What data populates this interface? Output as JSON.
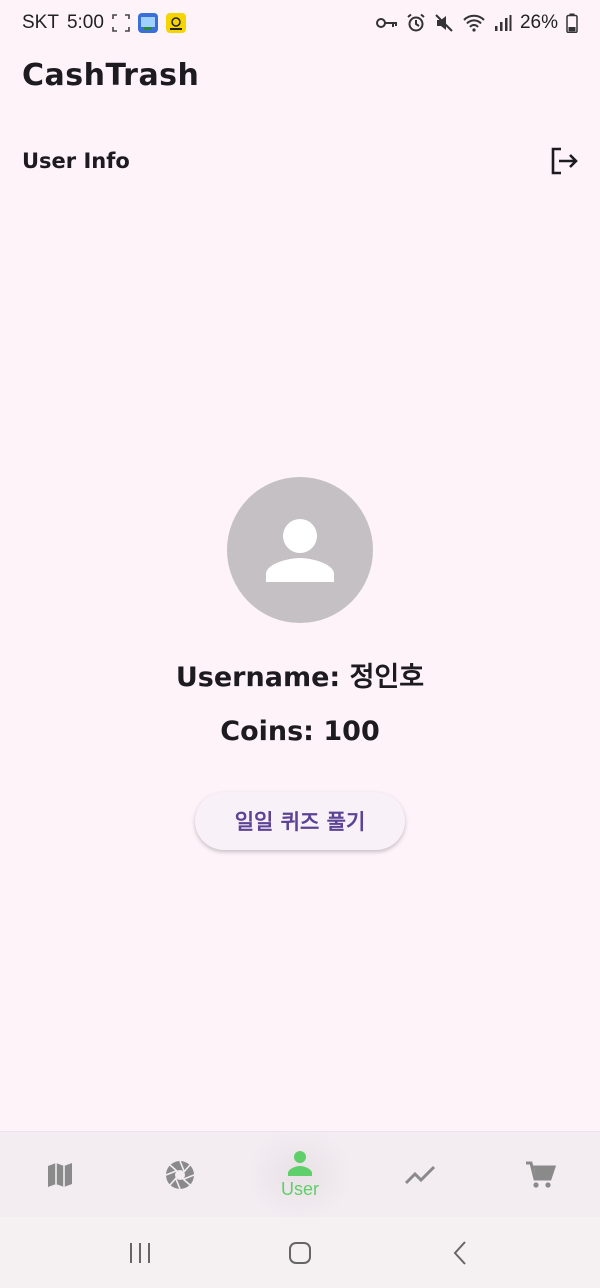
{
  "status_bar": {
    "carrier": "SKT",
    "time": "5:00",
    "battery": "26%",
    "icons_left": [
      "screenshot-frame-icon",
      "app-notification-icon",
      "yellow-app-icon"
    ],
    "icons_right": [
      "vpn-key-icon",
      "alarm-icon",
      "mute-icon",
      "wifi-icon",
      "signal-icon",
      "battery-icon"
    ]
  },
  "app": {
    "title": "CashTrash"
  },
  "header": {
    "title": "User Info",
    "logout_icon": "logout-icon"
  },
  "profile": {
    "avatar_icon": "person-icon",
    "username_text": "Username: 정인호",
    "coins_text": "Coins: 100",
    "quiz_button_label": "일일 퀴즈 풀기"
  },
  "bottom_nav": {
    "items": [
      {
        "icon": "map-icon",
        "label": ""
      },
      {
        "icon": "camera-shutter-icon",
        "label": ""
      },
      {
        "icon": "person-icon",
        "label": "User",
        "active": true
      },
      {
        "icon": "trending-icon",
        "label": ""
      },
      {
        "icon": "cart-icon",
        "label": ""
      }
    ],
    "active_color": "#5fcf6a",
    "inactive_color": "#8a8a8a"
  },
  "system_nav": {
    "items": [
      "recent-apps-icon",
      "home-icon",
      "back-icon"
    ]
  },
  "colors": {
    "background": "#fdf3f9",
    "avatar_bg": "#c4c0c4",
    "button_text": "#5c4396"
  }
}
